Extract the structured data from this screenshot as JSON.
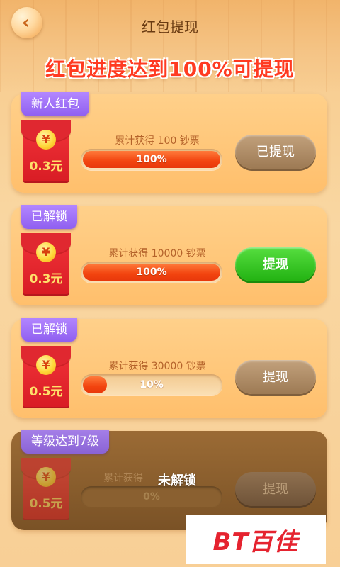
{
  "header": {
    "title": "红包提现",
    "back_icon": "chevron-left-icon",
    "headline": "红包进度达到100%可提现"
  },
  "colors": {
    "accent_red": "#ff3b22",
    "tag_purple": "#9b6df5",
    "progress_fill": "#f2440f",
    "button_green": "#22b212",
    "button_gray": "#9d7a54"
  },
  "cards": [
    {
      "tag": "新人红包",
      "coin_symbol": "¥",
      "amount": "0.3元",
      "requirement": "累计获得 100 钞票",
      "progress": 100,
      "progress_label": "100%",
      "button": "已提现",
      "button_state": "disabled"
    },
    {
      "tag": "已解锁",
      "coin_symbol": "¥",
      "amount": "0.3元",
      "requirement": "累计获得 10000 钞票",
      "progress": 100,
      "progress_label": "100%",
      "button": "提现",
      "button_state": "active"
    },
    {
      "tag": "已解锁",
      "coin_symbol": "¥",
      "amount": "0.5元",
      "requirement": "累计获得 30000 钞票",
      "progress": 10,
      "progress_label": "10%",
      "button": "提现",
      "button_state": "disabled"
    },
    {
      "tag": "等级达到7级",
      "coin_symbol": "¥",
      "amount": "0.5元",
      "requirement": "累计获得",
      "overlay": "未解锁",
      "progress": 0,
      "progress_label": "0%",
      "button": "提现",
      "button_state": "locked"
    }
  ],
  "watermark": {
    "text": "BT百佳"
  }
}
